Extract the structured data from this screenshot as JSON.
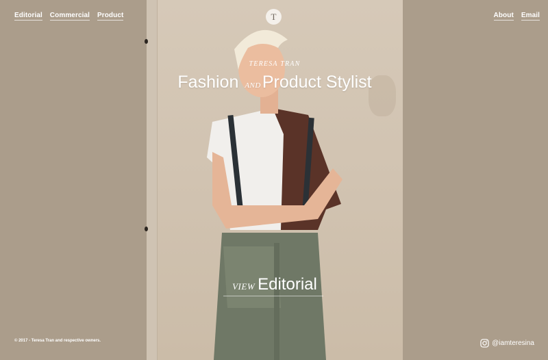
{
  "nav": {
    "left": [
      {
        "label": "Editorial"
      },
      {
        "label": "Commercial"
      },
      {
        "label": "Product"
      }
    ],
    "right": [
      {
        "label": "About"
      },
      {
        "label": "Email"
      }
    ]
  },
  "logo": {
    "letter": "T"
  },
  "hero": {
    "name": "TERESA TRAN",
    "title_part1": "Fashion",
    "title_and": "AND",
    "title_part2": "Product Stylist"
  },
  "cta": {
    "view": "VIEW",
    "category": "Editorial"
  },
  "footer": {
    "copyright": "© 2017 - Teresa Tran and respective owners.",
    "instagram": "@iamteresina"
  },
  "icons": {
    "instagram": "instagram-icon"
  },
  "colors": {
    "background": "#ab9d8b",
    "text": "#ffffff"
  }
}
